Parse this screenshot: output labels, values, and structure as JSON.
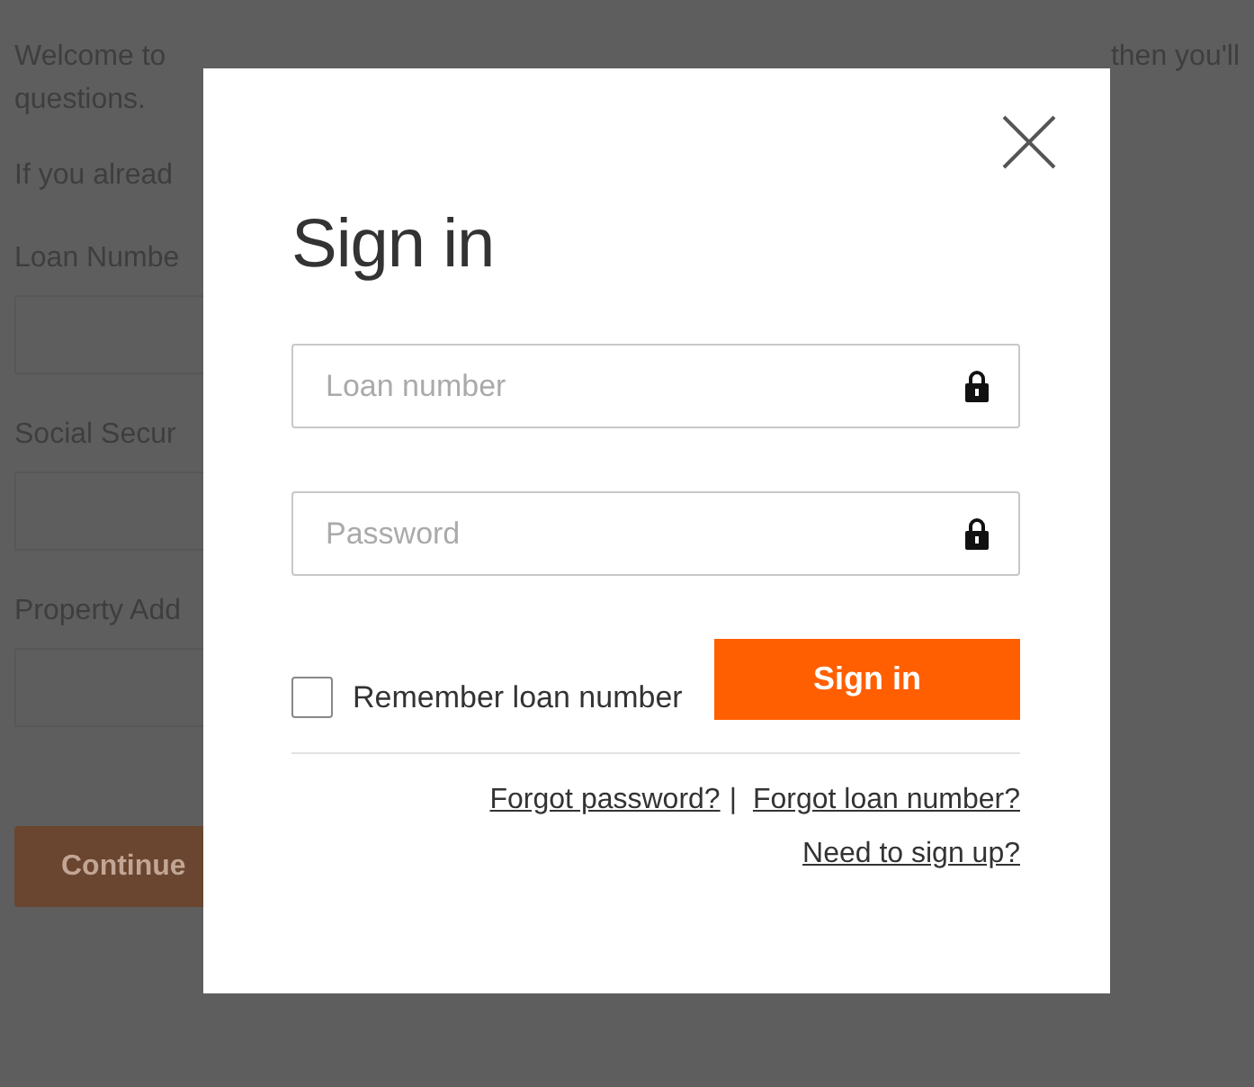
{
  "page": {
    "intro_left": "Welcome to",
    "intro_right": "then you'll",
    "intro_line2": "questions.",
    "intro_line3": "If you alread",
    "fields": [
      {
        "label": "Loan Numbe"
      },
      {
        "label": "Social Secur"
      },
      {
        "label": "Property Add"
      }
    ],
    "continue_button": "Continue"
  },
  "dialog": {
    "title": "Sign in",
    "fields": [
      {
        "placeholder": "Loan number"
      },
      {
        "placeholder": "Password"
      }
    ],
    "remember": {
      "label": "Remember loan number",
      "checked": false
    },
    "submit": "Sign in",
    "links": [
      "Forgot password?",
      "Forgot loan number?"
    ],
    "separator": "|",
    "signup_link": "Need to sign up?"
  }
}
